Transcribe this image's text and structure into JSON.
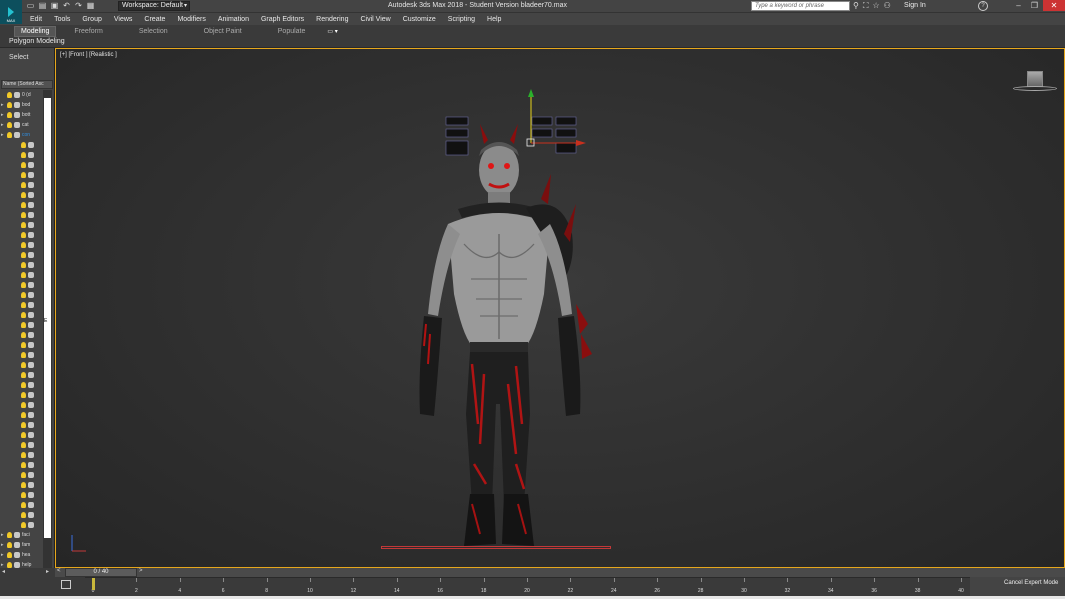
{
  "app": {
    "title": "Autodesk 3ds Max 2018 - Student Version   bladeer70.max",
    "logo_text": "MAX",
    "workspace_label": "Workspace: Default",
    "search_placeholder": "Type a keyword or phrase",
    "sign_in": "Sign In"
  },
  "menu": [
    "Edit",
    "Tools",
    "Group",
    "Views",
    "Create",
    "Modifiers",
    "Animation",
    "Graph Editors",
    "Rendering",
    "Civil View",
    "Customize",
    "Scripting",
    "Help"
  ],
  "ribbon": {
    "tabs": [
      "Modeling",
      "Freeform",
      "Selection",
      "Object Paint",
      "Populate"
    ],
    "active_tab": "Modeling",
    "sub_label": "Polygon Modeling"
  },
  "explorer": {
    "select_label": "Select",
    "column_header": "Name (Sorted Asc",
    "top_items": [
      {
        "label": "0 (d",
        "selected": false
      },
      {
        "label": "bod",
        "selected": false
      },
      {
        "label": "bott",
        "selected": false
      },
      {
        "label": "cat",
        "selected": false
      },
      {
        "label": "con",
        "selected": true
      }
    ],
    "bottom_items": [
      {
        "label": "faci"
      },
      {
        "label": "fam"
      },
      {
        "label": "hea"
      },
      {
        "label": "help"
      }
    ],
    "scroll_mark": "E"
  },
  "viewport": {
    "label": "[+] [Front ] [Realistic ]",
    "accent_color": "#e6a71c"
  },
  "timeline": {
    "frame_display": "0 / 40",
    "ticks": [
      "0",
      "2",
      "4",
      "6",
      "8",
      "10",
      "12",
      "14",
      "16",
      "18",
      "20",
      "22",
      "24",
      "26",
      "28",
      "30",
      "32",
      "34",
      "36",
      "38",
      "40"
    ]
  },
  "status": {
    "expert_mode": "Cancel Expert Mode"
  }
}
